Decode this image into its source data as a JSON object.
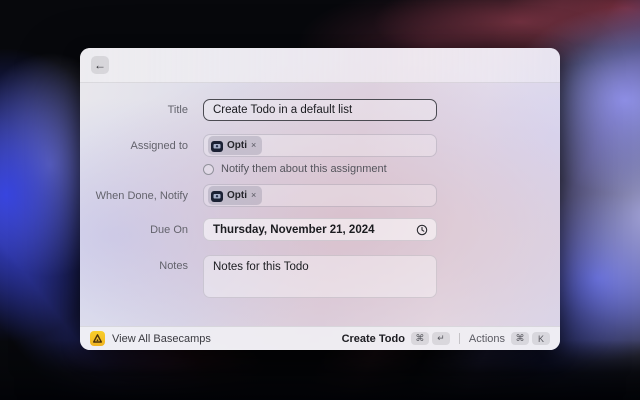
{
  "header": {
    "back_icon": "←"
  },
  "form": {
    "title": {
      "label": "Title",
      "value": "Create Todo in a default list"
    },
    "assigned": {
      "label": "Assigned to",
      "tag_name": "Opti",
      "tag_remove": "×"
    },
    "notify_checkbox": {
      "label": "Notify them about this assignment",
      "checked": false
    },
    "when_done": {
      "label": "When Done, Notify",
      "tag_name": "Opti",
      "tag_remove": "×"
    },
    "due_on": {
      "label": "Due On",
      "value": "Thursday, November 21, 2024",
      "icon": "clock-icon"
    },
    "notes": {
      "label": "Notes",
      "value": "Notes for this Todo"
    }
  },
  "footer": {
    "left_label": "View All Basecamps",
    "app_icon": "basecamp-icon",
    "primary_label": "Create Todo",
    "primary_keys": [
      "⌘",
      "↵"
    ],
    "actions_label": "Actions",
    "actions_keys": [
      "⌘",
      "K"
    ]
  },
  "colors": {
    "app_icon_yellow": "#f5c425",
    "focus_border": "#4b4b52",
    "window_tint_pink": "#ddd0de",
    "window_tint_lavender": "#d9d6ea"
  }
}
